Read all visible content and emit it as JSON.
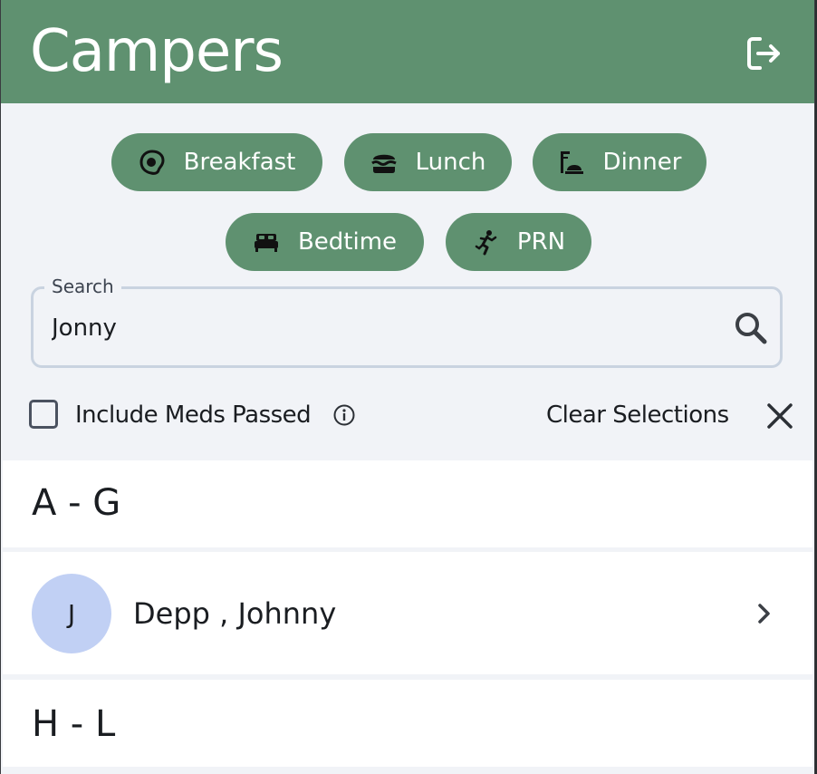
{
  "header": {
    "title": "Campers",
    "logout_icon": "logout-icon",
    "background": "#5f9170"
  },
  "filters": [
    {
      "label": "Breakfast",
      "icon": "egg-icon"
    },
    {
      "label": "Lunch",
      "icon": "burger-icon"
    },
    {
      "label": "Dinner",
      "icon": "dinner-icon"
    },
    {
      "label": "Bedtime",
      "icon": "bed-icon"
    },
    {
      "label": "PRN",
      "icon": "person-running-icon"
    }
  ],
  "search": {
    "legend": "Search",
    "value": "Jonny",
    "icon": "search-icon"
  },
  "options": {
    "include_meds_passed_label": "Include Meds Passed",
    "include_meds_passed_checked": false,
    "clear_selections_label": "Clear Selections"
  },
  "sections": [
    {
      "heading": "A - G",
      "rows": [
        {
          "initial": "J",
          "name": "Depp , Johnny"
        }
      ]
    },
    {
      "heading": "H - L",
      "rows": []
    }
  ],
  "colors": {
    "accent": "#5f9170",
    "avatar": "#c1d0f4",
    "page_bg": "#f1f3f7"
  }
}
